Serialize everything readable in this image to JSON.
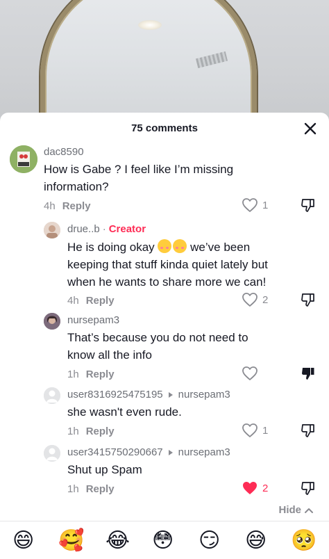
{
  "sheet": {
    "title": "75 comments",
    "hide_label": "Hide"
  },
  "comments": [
    {
      "username": "dac8590",
      "text_lines": [
        "How is Gabe ? I feel like I’m missing",
        "information?"
      ],
      "time": "4h",
      "reply_label": "Reply",
      "likes": "1",
      "liked": false,
      "disliked": false
    },
    {
      "username": "drue..b",
      "badge": "Creator",
      "text_lines": [
        "He is doing okay",
        "we’ve been",
        "keeping that stuff kinda quiet lately but",
        "when he wants to share more we can!"
      ],
      "time": "4h",
      "reply_label": "Reply",
      "likes": "2",
      "liked": false,
      "disliked": false
    },
    {
      "username": "nursepam3",
      "text_lines": [
        "That’s because you do not need to",
        "know all the info"
      ],
      "time": "1h",
      "reply_label": "Reply",
      "likes": "",
      "liked": false,
      "disliked": true
    },
    {
      "username": "user8316925475195",
      "reply_to": "nursepam3",
      "text_lines": [
        "she wasn't even rude."
      ],
      "time": "1h",
      "reply_label": "Reply",
      "likes": "1",
      "liked": false,
      "disliked": false
    },
    {
      "username": "user3415750290667",
      "reply_to": "nursepam3",
      "text_lines": [
        "Shut up Spam"
      ],
      "time": "1h",
      "reply_label": "Reply",
      "likes": "2",
      "liked": true,
      "disliked": false
    }
  ],
  "emoji_bar": [
    "😄",
    "🥰",
    "😂",
    "😳",
    "😏",
    "😅",
    "🥺"
  ],
  "colors": {
    "accent_red": "#fe2c55",
    "muted": "#8a8b91",
    "text": "#161823"
  }
}
